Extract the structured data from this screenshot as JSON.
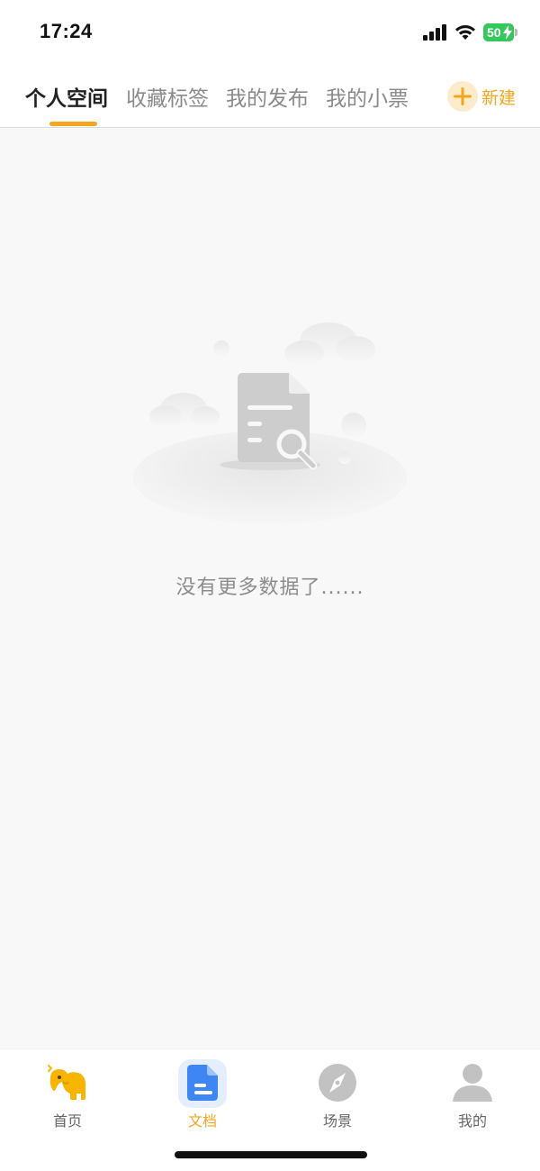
{
  "status_bar": {
    "time": "17:24",
    "battery_level": "50",
    "battery_color": "#34c759"
  },
  "tabs": [
    {
      "label": "个人空间",
      "active": true
    },
    {
      "label": "收藏标签",
      "active": false
    },
    {
      "label": "我的发布",
      "active": false
    },
    {
      "label": "我的小票",
      "active": false
    }
  ],
  "header": {
    "new_button_label": "新建",
    "accent_color": "#f5a623"
  },
  "empty_state": {
    "message": "没有更多数据了......",
    "icon": "document-search-icon"
  },
  "bottom_nav": [
    {
      "label": "首页",
      "icon": "elephant-icon",
      "active": false
    },
    {
      "label": "文档",
      "icon": "document-icon",
      "active": true
    },
    {
      "label": "场景",
      "icon": "compass-icon",
      "active": false
    },
    {
      "label": "我的",
      "icon": "user-icon",
      "active": false
    }
  ]
}
